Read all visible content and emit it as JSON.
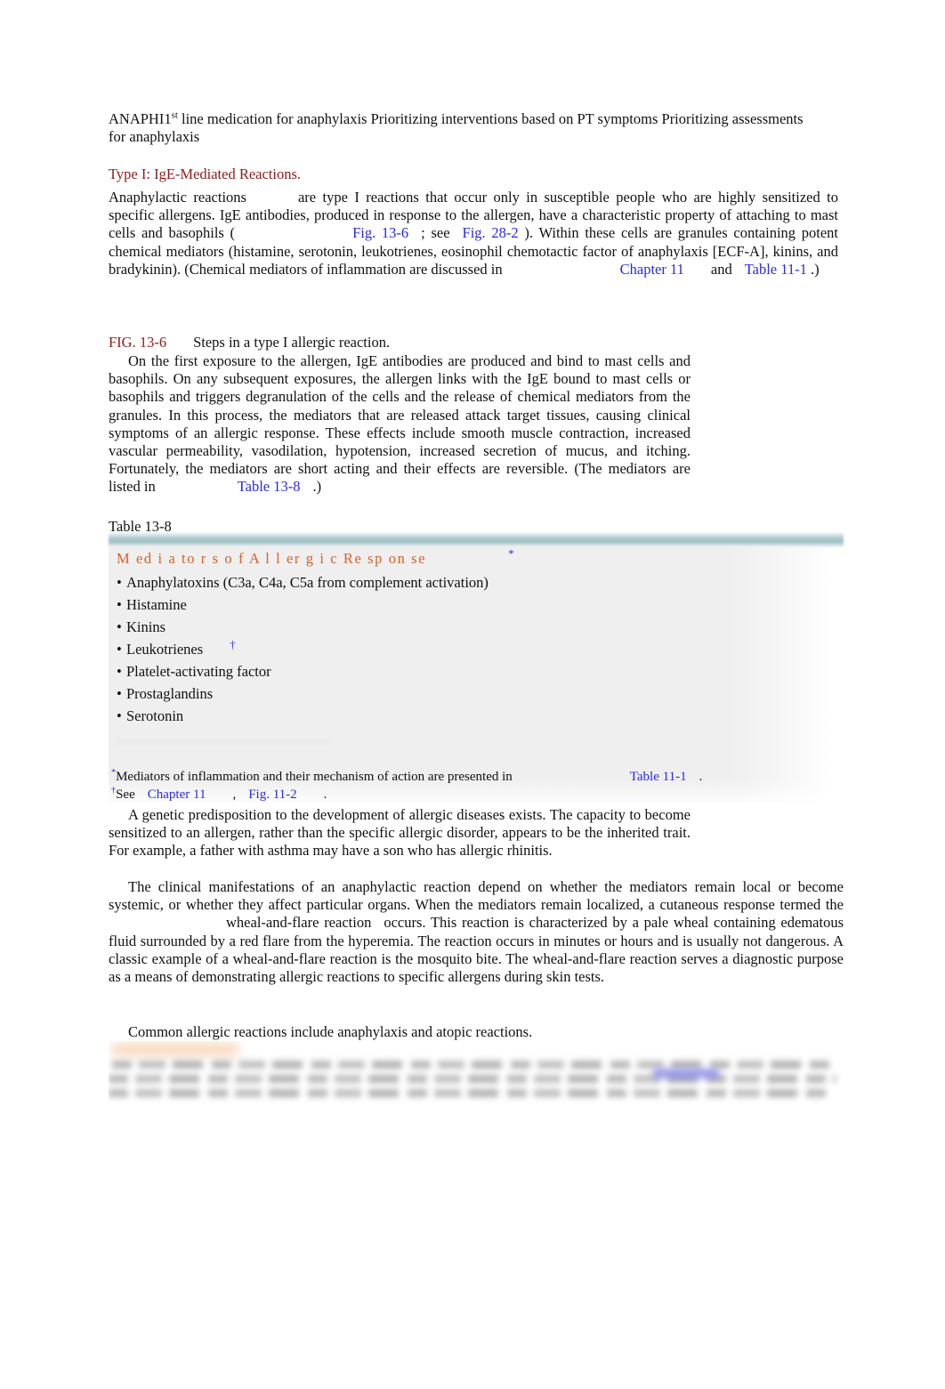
{
  "document": {
    "intro_line": {
      "prefix": "ANAPHI",
      "number": "1",
      "ordinal": "st",
      "rest": " line medication for anaphylaxis Prioritizing interventions based on PT symptoms Prioritizing assessments for anaphylaxis"
    },
    "type1_heading": "Type I: IgE-Mediated Reactions.",
    "anaphylactic_para": {
      "seg_1": "Anaphylactic reactions",
      "seg_2": "are type I reactions that occur only in susceptible people who are highly sensitized to specific allergens. IgE antibodies, produced in response to the allergen, have a characteristic property of attaching to mast cells and basophils (",
      "link_1": "Fig. 13-6",
      "seg_3": "; see",
      "link_2a": "Fig.",
      "link_2b": "28-2",
      "seg_4": "). Within these cells are granules containing potent chemical mediators (histamine, serotonin, leukotrienes, eosinophil chemotactic factor of anaphylaxis [ECF-A], kinins, and bradykinin). (Chemical mediators of inflammation are discussed in",
      "link_3": "Chapter 11",
      "seg_5": "and",
      "link_4a": "Table",
      "link_4b": "11-1",
      "seg_6": ".)"
    },
    "figure": {
      "label": "FIG. 13-6",
      "caption": "Steps in a type I allergic reaction.",
      "body_1": "On the first exposure to the allergen, IgE antibodies are produced and bind to mast cells and basophils. On any subsequent exposures, the allergen links with the IgE bound to mast cells or basophils and triggers degranulation of the cells and the release of chemical mediators from the granules. In this process, the mediators that are released attack target tissues, causing clinical symptoms of an allergic response. These effects include smooth muscle contraction, increased vascular permeability, vasodilation, hypotension, increased secretion of mucus, and itching. Fortunately, the mediators are short acting and their effects are reversible. (The mediators are listed in",
      "body_link": "Table 13-8",
      "body_2": ".)"
    },
    "table": {
      "caption": "Table 13-8",
      "title": "M ed i a to r s o f A l l er g i c Re sp on se",
      "title_mark": "*",
      "rows": [
        {
          "text": "Anaphylatoxins (C3a, C4a, C5a from complement activation)",
          "mark": ""
        },
        {
          "text": "Histamine",
          "mark": ""
        },
        {
          "text": "Kinins",
          "mark": ""
        },
        {
          "text": "Leukotrienes",
          "mark": "†"
        },
        {
          "text": "Platelet-activating factor",
          "mark": ""
        },
        {
          "text": "Prostaglandins",
          "mark": ""
        },
        {
          "text": "Serotonin",
          "mark": ""
        }
      ],
      "footnote_1": {
        "mark": "*",
        "text": "Mediators of inflammation and their mechanism of action are presented in",
        "link": "Table 11-1",
        "tail": "."
      },
      "footnote_2": {
        "mark": "†",
        "text": "See",
        "link_1": "Chapter 11",
        "sep": ",",
        "link_2": "Fig. 11-2",
        "tail": "."
      }
    },
    "genetic_para": "A genetic predisposition to the development of allergic diseases exists. The capacity to become sensitized to an allergen, rather than the specific allergic disorder, appears to be the inherited trait. For example, a father with asthma may have a son who has allergic rhinitis.",
    "manifestations_para": {
      "seg_1": "The clinical manifestations of an anaphylactic reaction depend on whether the mediators remain local or become systemic, or whether they affect particular organs. When the mediators remain localized, a cutaneous response termed the",
      "term_1": "wheal-and-flare",
      "term_2": "reaction",
      "seg_2": "occurs. This reaction is characterized by a pale wheal containing edematous fluid surrounded by a red flare from the hyperemia. The reaction occurs in minutes or hours and is usually not dangerous. A classic example of a wheal-and-flare reaction is the mosquito bite. The wheal-and-flare reaction serves a diagnostic purpose as a means of demonstrating allergic reactions to specific allergens during skin tests."
    },
    "common_reactions_para": "Common allergic reactions include anaphylaxis and atopic reactions."
  },
  "colors": {
    "heading_maroon": "#8c1c1c",
    "link_blue": "#2a2ae0",
    "table_title_orange": "#d2622a",
    "table_band": "#a4c4c9",
    "table_panel": "#efefef",
    "body_text": "#111111"
  }
}
